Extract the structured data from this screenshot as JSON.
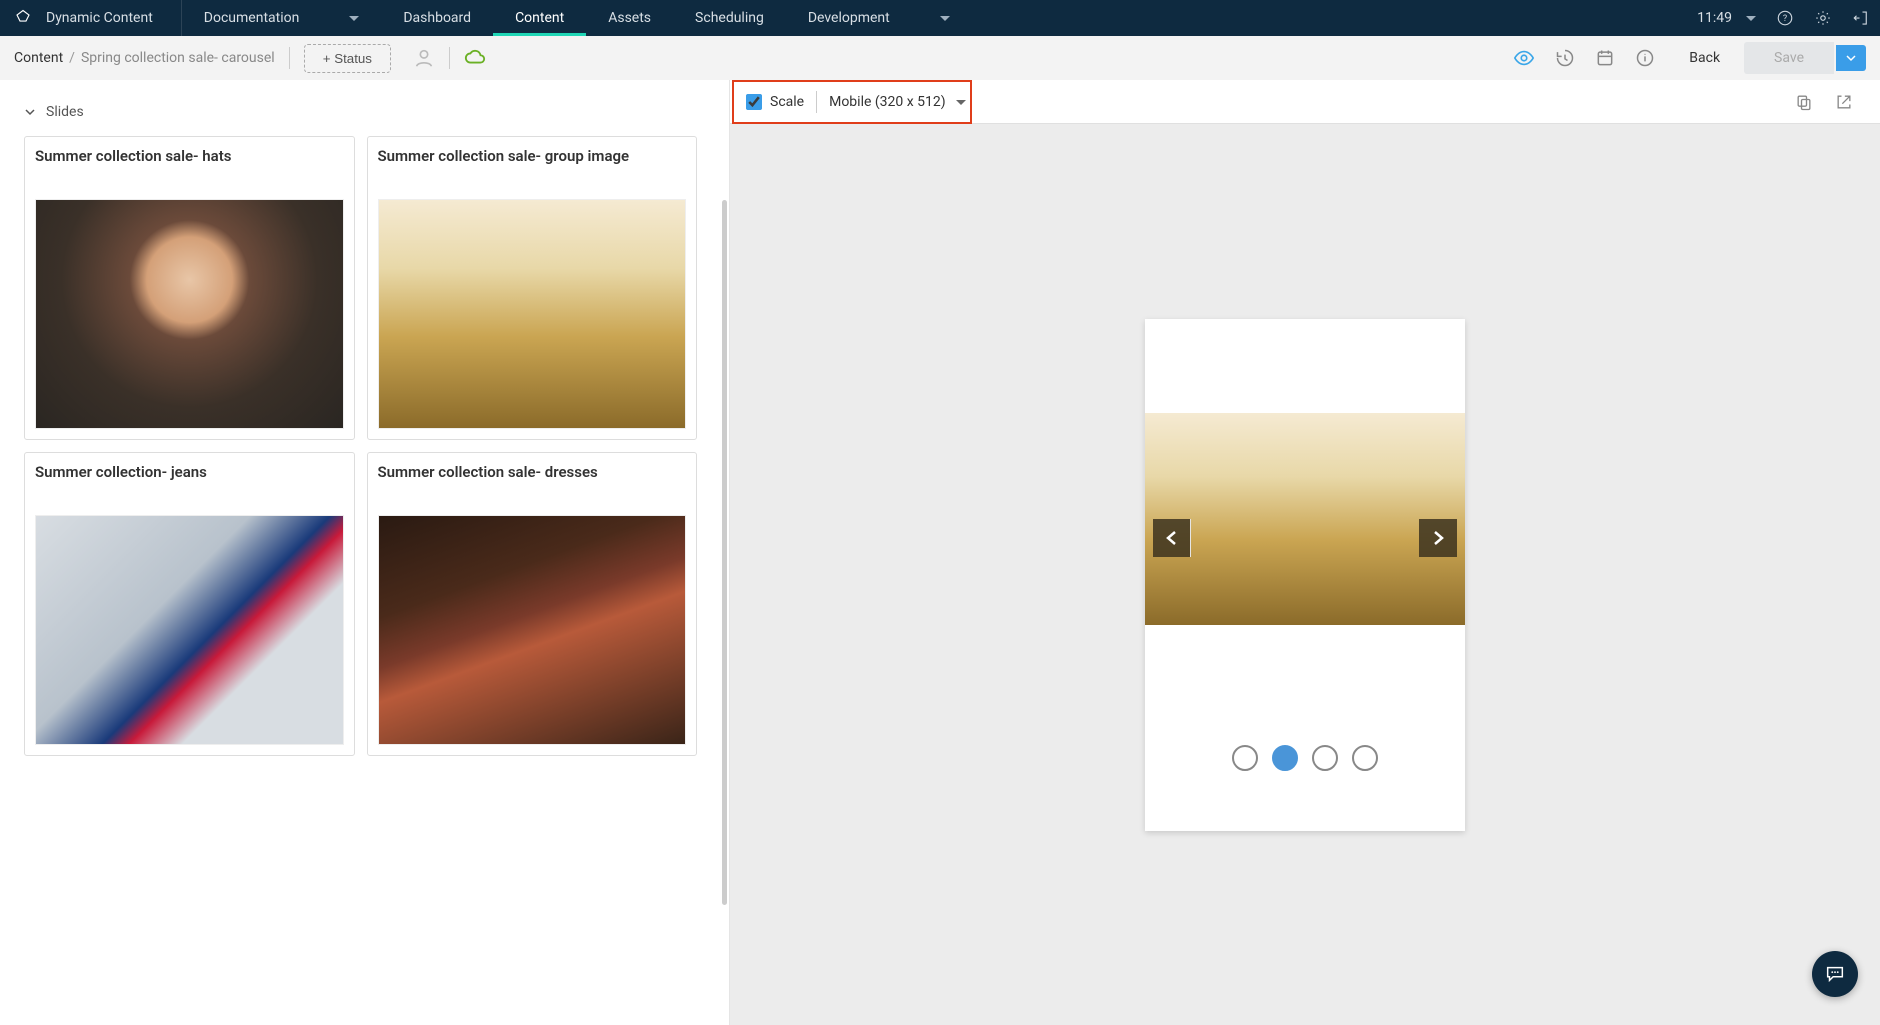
{
  "topnav": {
    "brand": "Dynamic Content",
    "items": [
      "Documentation",
      "Dashboard",
      "Content",
      "Assets",
      "Scheduling",
      "Development"
    ],
    "active_index": 2,
    "dropdown_indices": [
      0,
      5
    ],
    "time": "11:49"
  },
  "subbar": {
    "crumb_root": "Content",
    "crumb_item": "Spring collection sale- carousel",
    "status_btn": "+ Status",
    "back": "Back",
    "save": "Save"
  },
  "slides": {
    "header": "Slides",
    "cards": [
      {
        "title": "Summer collection sale- hats"
      },
      {
        "title": "Summer collection sale- group image"
      },
      {
        "title": "Summer collection- jeans"
      },
      {
        "title": "Summer collection sale- dresses"
      }
    ]
  },
  "preview_bar": {
    "scale_label": "Scale",
    "scale_checked": true,
    "device": "Mobile (320 x 512)"
  },
  "carousel": {
    "active_dot": 1,
    "dot_count": 4
  }
}
